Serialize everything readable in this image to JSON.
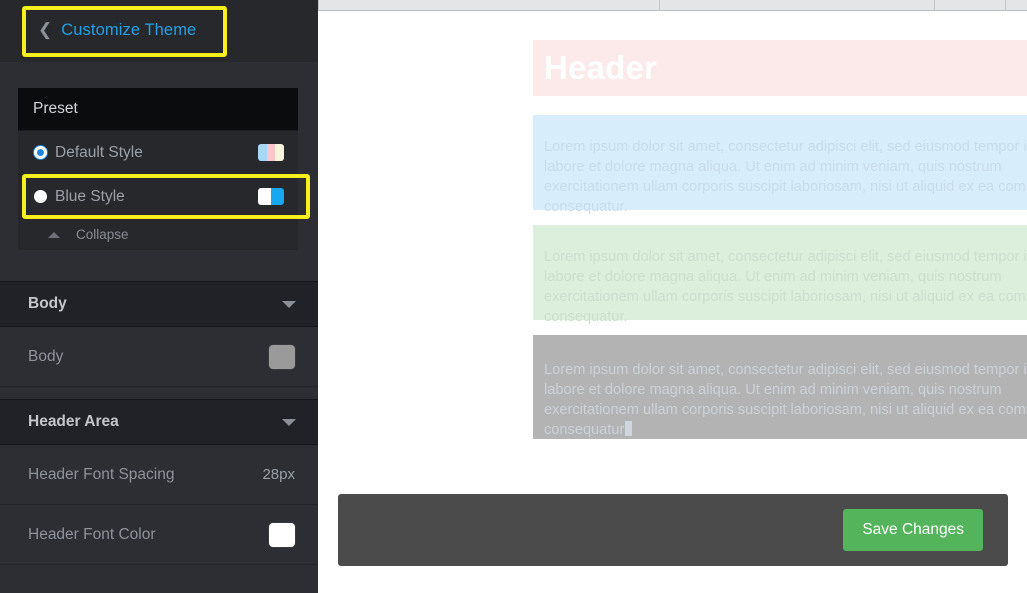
{
  "sidebar": {
    "back_label": "Customize Theme",
    "back_icon": "chevron-left-icon",
    "preset": {
      "header": "Preset",
      "items": [
        {
          "label": "Default Style",
          "selected": true,
          "swatch_colors": [
            "#a8d7f5",
            "#fcc6cf",
            "#f6f4dc"
          ]
        },
        {
          "label": "Blue Style",
          "selected": false,
          "swatch_colors": [
            "#ffffff",
            "#17a8ef"
          ]
        }
      ],
      "collapse_label": "Collapse",
      "collapse_icon": "caret-up-icon"
    },
    "sections": [
      {
        "title": "Body",
        "caret_icon": "caret-down-icon",
        "rows": [
          {
            "label": "Body",
            "value": "",
            "swatch": "#9a9a9a",
            "type": "color"
          }
        ]
      },
      {
        "title": "Header Area",
        "caret_icon": "caret-down-icon",
        "rows": [
          {
            "label": "Header Font Spacing",
            "value": "28px",
            "swatch": "",
            "type": "text"
          },
          {
            "label": "Header Font Color",
            "value": "",
            "swatch": "#ffffff",
            "type": "color"
          }
        ]
      }
    ],
    "highlights": [
      "customize-theme-back",
      "blue-style-row"
    ]
  },
  "preview": {
    "header_text": "Header",
    "help_icon": "question-mark-icon",
    "blocks": [
      {
        "name": "blue-text-block",
        "bg": "#d8edfb",
        "text": "Lorem ipsum dolor sit amet, consectetur adipisci elit, sed eiusmod tempor incidunt ut labore et dolore magna aliqua. Ut enim ad minim veniam, quis nostrum exercitationem ullam corporis suscipit laboriosam, nisi ut aliquid ex ea commodi consequatur."
      },
      {
        "name": "green-text-block",
        "bg": "#dceedc",
        "text": "Lorem ipsum dolor sit amet, consectetur adipisci elit, sed eiusmod tempor incidunt ut labore et dolore magna aliqua. Ut enim ad minim veniam, quis nostrum exercitationem ullam corporis suscipit laboriosam, nisi ut aliquid ex ea commodi consequatur."
      },
      {
        "name": "gray-text-block",
        "bg": "#b3b3b3",
        "text": "Lorem ipsum dolor sit amet, consectetur adipisci elit, sed eiusmod tempor incidunt ut labore et dolore magna aliqua. Ut enim ad minim veniam, quis nostrum exercitationem ullam corporis suscipit laboriosam, nisi ut aliquid ex ea commodi consequatur"
      }
    ],
    "footer": {
      "save_label": "Save Changes",
      "save_color": "#53b45b"
    }
  },
  "theme": {
    "sidebar_bg": "#2c2e33",
    "section_header_bg": "#212227",
    "accent_link": "#23a0e8",
    "highlight": "#f5ee14"
  }
}
